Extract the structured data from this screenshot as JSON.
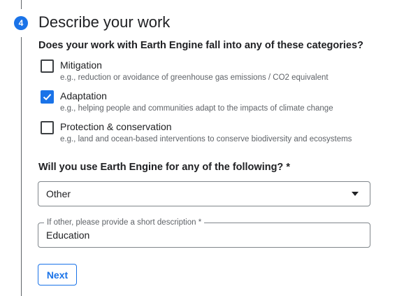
{
  "step": {
    "number": "4",
    "title": "Describe your work"
  },
  "categories": {
    "question": "Does your work with Earth Engine fall into any of these categories?",
    "options": [
      {
        "label": "Mitigation",
        "hint": "e.g., reduction or avoidance of greenhouse gas emissions / CO2 equivalent",
        "checked": false
      },
      {
        "label": "Adaptation",
        "hint": "e.g., helping people and communities adapt to the impacts of climate change",
        "checked": true
      },
      {
        "label": "Protection & conservation",
        "hint": "e.g., land and ocean-based interventions to conserve biodiversity and ecosystems",
        "checked": false
      }
    ]
  },
  "usage": {
    "question": "Will you use Earth Engine for any of the following? *",
    "selected": "Other"
  },
  "other_description": {
    "label": "If other, please provide a short description *",
    "value": "Education"
  },
  "next_label": "Next",
  "colors": {
    "accent": "#1a73e8",
    "text": "#202124",
    "hint": "#5f6368",
    "border": "#80868b"
  },
  "icons": {
    "checkmark": "check-icon",
    "dropdown": "dropdown-arrow-icon"
  }
}
